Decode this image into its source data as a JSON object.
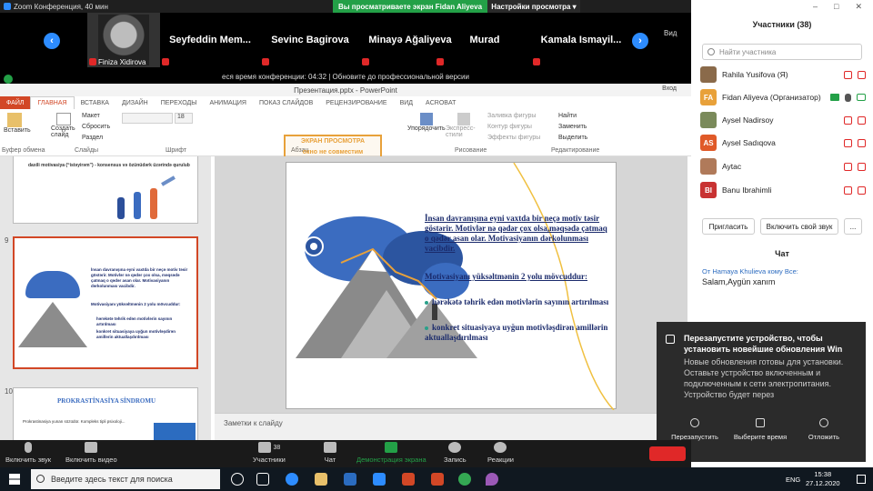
{
  "zoom": {
    "window_title": "Zoom Конференция, 40 мин",
    "share_banner": "Вы просматриваете экран Fidan Aliyeva",
    "view_settings": "Настройки просмотра",
    "view_label": "Вид",
    "timer_text": "еся время конференции: 04:32 | Обновите до профессиональной версии",
    "video_tiles": [
      {
        "name": "Finiza Xidirova"
      },
      {
        "name": "Seyfeddin Mem..."
      },
      {
        "name": "Sevinc Bagirova"
      },
      {
        "name": "Minayə Ağaliyeva"
      },
      {
        "name": "Murad"
      },
      {
        "name": "Kamala Ismayil..."
      }
    ],
    "toolbar": {
      "mute": "Включить звук",
      "video": "Включить видео",
      "participants": "Участники",
      "participants_count": "38",
      "chat": "Чат",
      "share": "Демонстрация экрана",
      "record": "Запись",
      "reactions": "Реакции"
    }
  },
  "powerpoint": {
    "title": "Презентация.pptx - PowerPoint",
    "login": "Вход",
    "tabs": [
      "ФАЙЛ",
      "ГЛАВНАЯ",
      "ВСТАВКА",
      "ДИЗАЙН",
      "ПЕРЕХОДЫ",
      "АНИМАЦИЯ",
      "ПОКАЗ СЛАЙДОВ",
      "РЕЦЕНЗИРОВАНИЕ",
      "ВИД",
      "ACROBAT"
    ],
    "ribbon": {
      "paste": "Вставить",
      "clipboard": "Буфер обмена",
      "create_slide": "Создать слайд",
      "layout": "Макет",
      "reset": "Сбросить",
      "section": "Раздел",
      "slides": "Слайды",
      "font": "Шрифт",
      "paragraph": "Абзац",
      "arrange": "Упорядочить",
      "quick_styles": "Экспресс-стили",
      "drawing": "Рисование",
      "fill": "Заливка фигуры",
      "outline": "Контур фигуры",
      "effects": "Эффекты фигуры",
      "find": "Найти",
      "replace": "Заменить",
      "select": "Выделить",
      "editing": "Редактирование",
      "font_size": "18",
      "watermark_line1": "ЭКРАН ПРОСМОТРА",
      "watermark_line2": "окно не совместим"
    },
    "thumb_top_text": "daxili motivasiya (“istəyirəm”) - konsensus və özünüdərk üzərində qurulub",
    "thumb9_number": "9",
    "thumb10_number": "10",
    "thumb9": {
      "para1": "İnsan davranışına eyni vaxtda bir neçə motiv təsir göstərir. Motivlər nə qədər çox olsa, məqsədə çatmaq o qədər asan olar. Motivasiyanın dərkolunması vacibdir.",
      "para2": "Motivasiyanı yüksəltmənin 2 yolu mövcuddur:",
      "b1": "hərəkətə təhrik edən motivlərin sayının artırılması",
      "b2": "konkret situasiyaya uyğun motivləşdirən amillərin aktuallaşdırılması"
    },
    "thumb10": {
      "title": "PROKRASTİNASİYA SİNDROMU",
      "text": "Prokrastinasiya yunan sözüdür. Kompleks tipli psixoloji..."
    },
    "slide": {
      "para1": "İnsan davranışına eyni vaxtda bir neçə motiv təsir göstərir. Motivlər nə qədər çox olsa,məqsədə çatmaq o qədər asan olar. Motivasiyanın dərkolunması vacibdir.",
      "para2": "Motivasiyanı yüksəltmənin 2 yolu mövcuddur:",
      "bullet1": "hərəkətə təhrik edən motivlərin sayının artırılması",
      "bullet2": "konkret situasiyaya uyğun motivləşdirən amillərin aktuallaşdırılması"
    },
    "notes": "Заметки к слайду"
  },
  "panel": {
    "title": "Участники (38)",
    "search_placeholder": "Найти участника",
    "participants": [
      {
        "name": "Rahila Yusifova (Я)",
        "initials": "",
        "color": "#8a6a4a"
      },
      {
        "name": "Fidan Aliyeva (Организатор)",
        "initials": "FA",
        "color": "#e8a13a"
      },
      {
        "name": "Aysel Nadirsoy",
        "initials": "",
        "color": "#7a8a5a"
      },
      {
        "name": "Aysel Sadıqova",
        "initials": "AS",
        "color": "#e05a28"
      },
      {
        "name": "Aytac",
        "initials": "",
        "color": "#b07a5a"
      },
      {
        "name": "Banu Ibrahimli",
        "initials": "BI",
        "color": "#c83232"
      }
    ],
    "invite": "Пригласить",
    "unmute_me": "Включить свой звук",
    "more": "...",
    "chat_title": "Чат",
    "chat_from": "От Hamaya Khulieva кому Все:",
    "chat_message": "Salam,Aygün xanım"
  },
  "notification": {
    "title": "Перезапустите устройство, чтобы установить новейшие обновления Win",
    "body": "Новые обновления готовы для установки. Оставьте устройство включенным и подключенным к сети электропитания. Устройство будет перез",
    "restart": "Перезапустить",
    "pick_time": "Выберите время",
    "snooze": "Отложить"
  },
  "taskbar": {
    "search_placeholder": "Введите здесь текст для поиска",
    "lang": "ENG",
    "time": "15:38",
    "date": "27.12.2020"
  }
}
